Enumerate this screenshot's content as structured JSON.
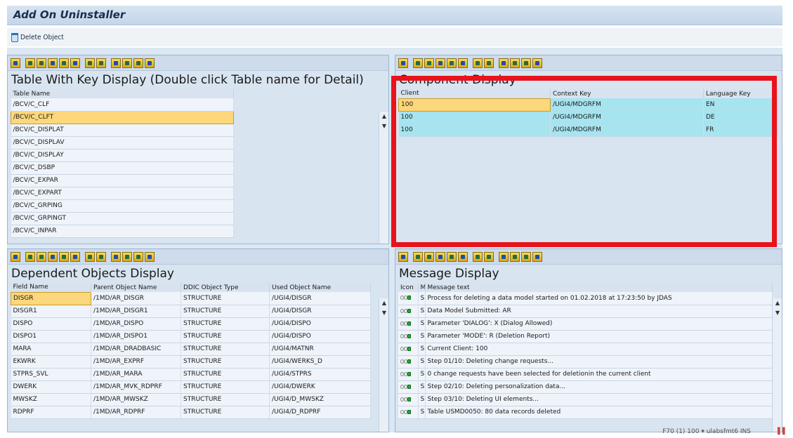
{
  "window": {
    "title": "Add On Uninstaller"
  },
  "toolbar": {
    "delete_label": "Delete Object"
  },
  "table_panel": {
    "title": "Table With Key Display (Double click Table name for Detail)",
    "column": "Table Name",
    "rows": [
      "/BCV/C_CLF",
      "/BCV/C_CLFT",
      "/BCV/C_DISPLAT",
      "/BCV/C_DISPLAV",
      "/BCV/C_DISPLAY",
      "/BCV/C_DSBP",
      "/BCV/C_EXPAR",
      "/BCV/C_EXPART",
      "/BCV/C_GRPING",
      "/BCV/C_GRPINGT",
      "/BCV/C_INPAR"
    ]
  },
  "component_panel": {
    "title": "Component Display",
    "columns": [
      "Client",
      "Context Key",
      "Language Key"
    ],
    "rows": [
      [
        "100",
        "/UGI4/MDGRFM",
        "EN"
      ],
      [
        "100",
        "/UGI4/MDGRFM",
        "DE"
      ],
      [
        "100",
        "/UGI4/MDGRFM",
        "FR"
      ]
    ]
  },
  "dependent_panel": {
    "title": "Dependent Objects Display",
    "columns": [
      "Field Name",
      "Parent Object Name",
      "DDIC Object Type",
      "Used Object Name"
    ],
    "rows": [
      [
        "DISGR",
        "/1MD/AR_DISGR",
        "STRUCTURE",
        "/UGI4/DISGR"
      ],
      [
        "DISGR1",
        "/1MD/AR_DISGR1",
        "STRUCTURE",
        "/UGI4/DISGR"
      ],
      [
        "DISPO",
        "/1MD/AR_DISPO",
        "STRUCTURE",
        "/UGI4/DISPO"
      ],
      [
        "DISPO1",
        "/1MD/AR_DISPO1",
        "STRUCTURE",
        "/UGI4/DISPO"
      ],
      [
        "MARA",
        "/1MD/AR_DRADBASIC",
        "STRUCTURE",
        "/UGI4/MATNR"
      ],
      [
        "EKWRK",
        "/1MD/AR_EXPRF",
        "STRUCTURE",
        "/UGI4/WERKS_D"
      ],
      [
        "STPRS_SVL",
        "/1MD/AR_MARA",
        "STRUCTURE",
        "/UGI4/STPRS"
      ],
      [
        "DWERK",
        "/1MD/AR_MVK_RDPRF",
        "STRUCTURE",
        "/UGI4/DWERK"
      ],
      [
        "MWSKZ",
        "/1MD/AR_MWSKZ",
        "STRUCTURE",
        "/UGI4/D_MWSKZ"
      ],
      [
        "RDPRF",
        "/1MD/AR_RDPRF",
        "STRUCTURE",
        "/UGI4/D_RDPRF"
      ]
    ]
  },
  "message_panel": {
    "title": "Message Display",
    "columns": [
      "Icon",
      "M",
      "Message text"
    ],
    "rows": [
      [
        "S",
        "Process for deleting a data model started on 01.02.2018 at 17:23:50 by JDAS"
      ],
      [
        "S",
        "Data Model Submitted: AR"
      ],
      [
        "S",
        "Parameter 'DIALOG': X (Dialog Allowed)"
      ],
      [
        "S",
        "Parameter 'MODE': R (Deletion Report)"
      ],
      [
        "S",
        "Current Client: 100"
      ],
      [
        "S",
        "Step 01/10: Deleting change requests..."
      ],
      [
        "S",
        "0 change requests have been selected for deletionin the current client"
      ],
      [
        "S",
        "Step 02/10: Deleting personalization data..."
      ],
      [
        "S",
        "Step 03/10: Deleting UI elements..."
      ],
      [
        "S",
        "Table USMD0050: 80 data records deleted"
      ]
    ]
  },
  "status": {
    "text": "F70 (1) 100 ▾  ulabsfmt6  INS"
  },
  "colors": {
    "highlight": "#e8131b",
    "selection": "#fcd77b",
    "component_row": "#a6e4f0"
  }
}
